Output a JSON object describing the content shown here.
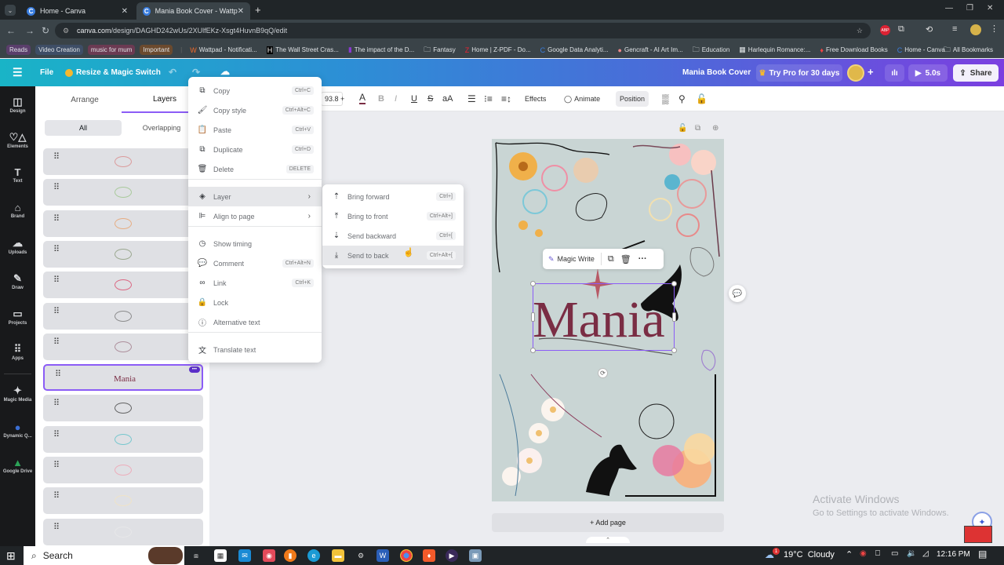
{
  "browser": {
    "tabs": [
      {
        "title": "Home - Canva",
        "active": false
      },
      {
        "title": "Mania Book Cover - Wattpad B",
        "active": true
      }
    ],
    "new_tab_label": "+",
    "url_host": "canva.com",
    "url_path": "/design/DAGHD242wUs/2XUlfEKz-Xsgt4HuvnB9qQ/edit",
    "bookmark_chips": [
      {
        "label": "Reads",
        "color": "#5a3e6b"
      },
      {
        "label": "Video Creation",
        "color": "#3e4e66"
      },
      {
        "label": "music for mum",
        "color": "#6b3a52"
      },
      {
        "label": "Important",
        "color": "#6b4a2e"
      }
    ],
    "bookmarks": [
      {
        "icon": "W",
        "label": "Wattpad - Notificati..."
      },
      {
        "icon": "H",
        "label": "The Wall Street Cras..."
      },
      {
        "icon": "▮",
        "label": "The impact of the D..."
      },
      {
        "icon": "🗀",
        "label": "Fantasy"
      },
      {
        "icon": "Z",
        "label": "Home | Z-PDF - Do..."
      },
      {
        "icon": "C",
        "label": "Google Data Analyti..."
      },
      {
        "icon": "●",
        "label": "Gencraft - AI Art Im..."
      },
      {
        "icon": "🗀",
        "label": "Education"
      },
      {
        "icon": "▦",
        "label": "Harlequin Romance:..."
      },
      {
        "icon": "♦",
        "label": "Free Download Books"
      },
      {
        "icon": "C",
        "label": "Home - Canva"
      }
    ],
    "all_bookmarks": "All Bookmarks"
  },
  "header": {
    "file": "File",
    "resize": "Resize & Magic Switch",
    "doc_title": "Mania Book Cover",
    "try_pro": "Try Pro for 30 days",
    "play_duration": "5.0s",
    "share": "Share"
  },
  "rail": [
    {
      "icon": "◫",
      "label": "Design"
    },
    {
      "icon": "♡△",
      "label": "Elements"
    },
    {
      "icon": "T",
      "label": "Text"
    },
    {
      "icon": "⌂",
      "label": "Brand"
    },
    {
      "icon": "☁",
      "label": "Uploads"
    },
    {
      "icon": "✎",
      "label": "Draw"
    },
    {
      "icon": "▭",
      "label": "Projects"
    },
    {
      "icon": "⠿",
      "label": "Apps"
    },
    {
      "icon": "✦",
      "label": "Magic Media"
    },
    {
      "icon": "●",
      "label": "Dynamic Q..."
    },
    {
      "icon": "▲",
      "label": "Google Drive"
    }
  ],
  "panel": {
    "tabs": [
      "Arrange",
      "Layers"
    ],
    "active_tab": "Layers",
    "filters": [
      "All",
      "Overlapping"
    ],
    "active_filter": "All",
    "layers": [
      {
        "thumb": "floral-corner",
        "color": "#d98a8a"
      },
      {
        "thumb": "green-wreath",
        "color": "#9bc48a"
      },
      {
        "thumb": "orange-flower",
        "color": "#e8a06a"
      },
      {
        "thumb": "white-flowers",
        "color": "#8a9a7a"
      },
      {
        "thumb": "pink-sprig",
        "color": "#d94a6a"
      },
      {
        "thumb": "branch",
        "color": "#777"
      },
      {
        "thumb": "branch-pink",
        "color": "#a07a8a"
      },
      {
        "thumb": "text",
        "text": "Mania",
        "selected": true
      },
      {
        "thumb": "butterfly",
        "color": "#444"
      },
      {
        "thumb": "teal-wreath",
        "color": "#5bc0c8"
      },
      {
        "thumb": "pink-floral",
        "color": "#f0a0b0"
      },
      {
        "thumb": "faint-yellow",
        "color": "#f3e3c0"
      },
      {
        "thumb": "faint-white",
        "color": "#e8e8ea"
      }
    ]
  },
  "toolbar": {
    "font_size": "93.8",
    "plus": "+",
    "effects": "Effects",
    "animate": "Animate",
    "position": "Position"
  },
  "context_menu": {
    "items": [
      {
        "icon": "⧉",
        "label": "Copy",
        "shortcut": "Ctrl+C"
      },
      {
        "icon": "🖌",
        "label": "Copy style",
        "shortcut": "Ctrl+Alt+C"
      },
      {
        "icon": "📋",
        "label": "Paste",
        "shortcut": "Ctrl+V"
      },
      {
        "icon": "⧉",
        "label": "Duplicate",
        "shortcut": "Ctrl+D"
      },
      {
        "icon": "🗑",
        "label": "Delete",
        "shortcut": "DELETE"
      },
      {
        "icon": "◈",
        "label": "Layer",
        "submenu": true
      },
      {
        "icon": "⊫",
        "label": "Align to page",
        "submenu": true
      },
      {
        "icon": "◷",
        "label": "Show timing"
      },
      {
        "icon": "💬",
        "label": "Comment",
        "shortcut": "Ctrl+Alt+N"
      },
      {
        "icon": "∞",
        "label": "Link",
        "shortcut": "Ctrl+K"
      },
      {
        "icon": "🔒",
        "label": "Lock"
      },
      {
        "icon": "ⓘ",
        "label": "Alternative text"
      },
      {
        "icon": "文",
        "label": "Translate text"
      }
    ]
  },
  "layer_submenu": {
    "items": [
      {
        "icon": "⇡",
        "label": "Bring forward",
        "shortcut": "Ctrl+]"
      },
      {
        "icon": "⤒",
        "label": "Bring to front",
        "shortcut": "Ctrl+Alt+]"
      },
      {
        "icon": "⇣",
        "label": "Send backward",
        "shortcut": "Ctrl+["
      },
      {
        "icon": "⤓",
        "label": "Send to back",
        "shortcut": "Ctrl+Alt+["
      }
    ]
  },
  "canvas": {
    "title_text": "Mania",
    "title_color": "#7a2d44",
    "bg_color": "#c9d5d4",
    "float_toolbar": {
      "magic_write": "Magic Write"
    },
    "add_page": "+ Add page"
  },
  "watermark": {
    "title": "Activate Windows",
    "subtitle": "Go to Settings to activate Windows."
  },
  "taskbar": {
    "search": "Search",
    "weather": "19°C  Cloudy",
    "weather_badge": "1",
    "time": "12:16 PM"
  }
}
